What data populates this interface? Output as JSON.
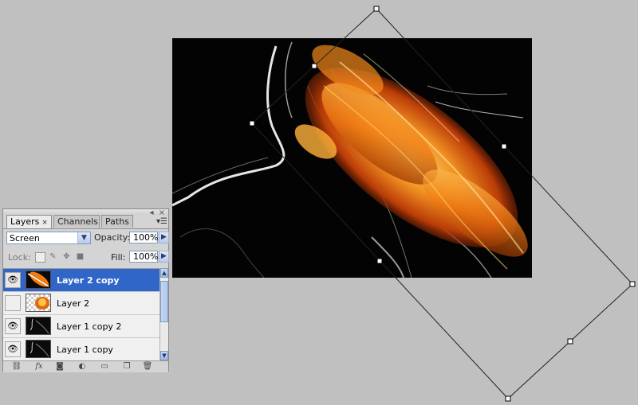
{
  "panel": {
    "tabs": [
      {
        "label": "Layers",
        "close": "×"
      },
      {
        "label": "Channels"
      },
      {
        "label": "Paths"
      }
    ],
    "blend_mode": "Screen",
    "opacity_label": "Opacity:",
    "opacity_value": "100%",
    "lock_label": "Lock:",
    "fill_label": "Fill:",
    "fill_value": "100%",
    "layers": [
      {
        "name": "Layer 2 copy",
        "visible": true,
        "selected": true
      },
      {
        "name": "Layer 2",
        "visible": false,
        "selected": false
      },
      {
        "name": "Layer 1 copy 2",
        "visible": true,
        "selected": false
      },
      {
        "name": "Layer 1 copy",
        "visible": true,
        "selected": false
      }
    ]
  },
  "icons": {
    "eye": "eye-icon",
    "dropdown": "chevron-down-icon",
    "flyout": "triangle-right-icon",
    "lock_transparency": "checker-icon",
    "lock_paint": "brush-icon",
    "lock_position": "move-icon",
    "lock_all": "lock-icon",
    "link": "link-icon",
    "fx": "fx-icon",
    "mask": "mask-icon",
    "adjustment": "half-circle-icon",
    "group": "folder-icon",
    "new_layer": "new-layer-icon",
    "delete": "trash-icon"
  },
  "colors": {
    "background": "#c0c0c0",
    "selection": "#3166c9",
    "fire_orange": "#f07a12",
    "fire_yellow": "#ffd24a"
  }
}
